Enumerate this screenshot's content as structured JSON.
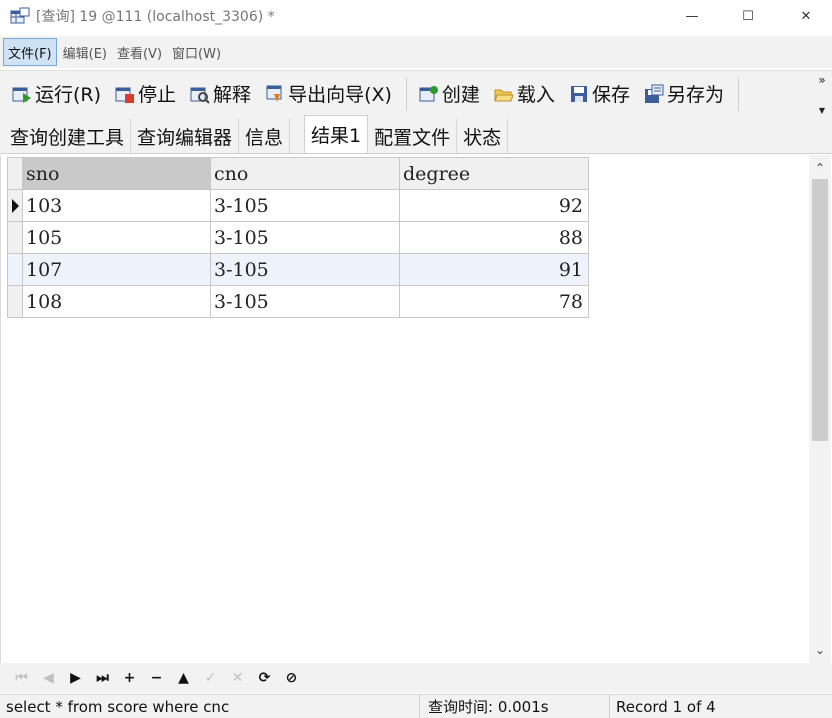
{
  "window": {
    "title": "[查询] 19 @111 (localhost_3306) *",
    "controls": {
      "minimize": "—",
      "maximize": "☐",
      "close": "✕"
    }
  },
  "menu": [
    {
      "label": "文件(F)",
      "active": true
    },
    {
      "label": "编辑(E)"
    },
    {
      "label": "查看(V)"
    },
    {
      "label": "窗口(W)"
    }
  ],
  "toolbar": {
    "run": "运行(R)",
    "stop": "停止",
    "explain": "解释",
    "export_wizard": "导出向导(X)",
    "create": "创建",
    "load": "载入",
    "save": "保存",
    "save_as": "另存为",
    "overflow": "»"
  },
  "tabs": [
    {
      "label": "查询创建工具"
    },
    {
      "label": "查询编辑器"
    },
    {
      "label": "信息"
    },
    {
      "label": "结果1",
      "active": true
    },
    {
      "label": "配置文件"
    },
    {
      "label": "状态"
    }
  ],
  "grid": {
    "columns": [
      "sno",
      "cno",
      "degree"
    ],
    "rows": [
      {
        "sno": "103",
        "cno": "3-105",
        "degree": "92"
      },
      {
        "sno": "105",
        "cno": "3-105",
        "degree": "88"
      },
      {
        "sno": "107",
        "cno": "3-105",
        "degree": "91"
      },
      {
        "sno": "108",
        "cno": "3-105",
        "degree": "78"
      }
    ],
    "current_row": 0
  },
  "navigator": {
    "first": "⏮",
    "prev": "◀",
    "next": "▶",
    "last": "⏭",
    "add": "+",
    "delete": "−",
    "post": "▲",
    "edit": "✓",
    "cancel": "✕",
    "refresh": "⟳",
    "stop": "⊘"
  },
  "status": {
    "sql": "select * from score  where  cnc",
    "time": "查询时间: 0.001s",
    "record": "Record 1 of 4"
  }
}
